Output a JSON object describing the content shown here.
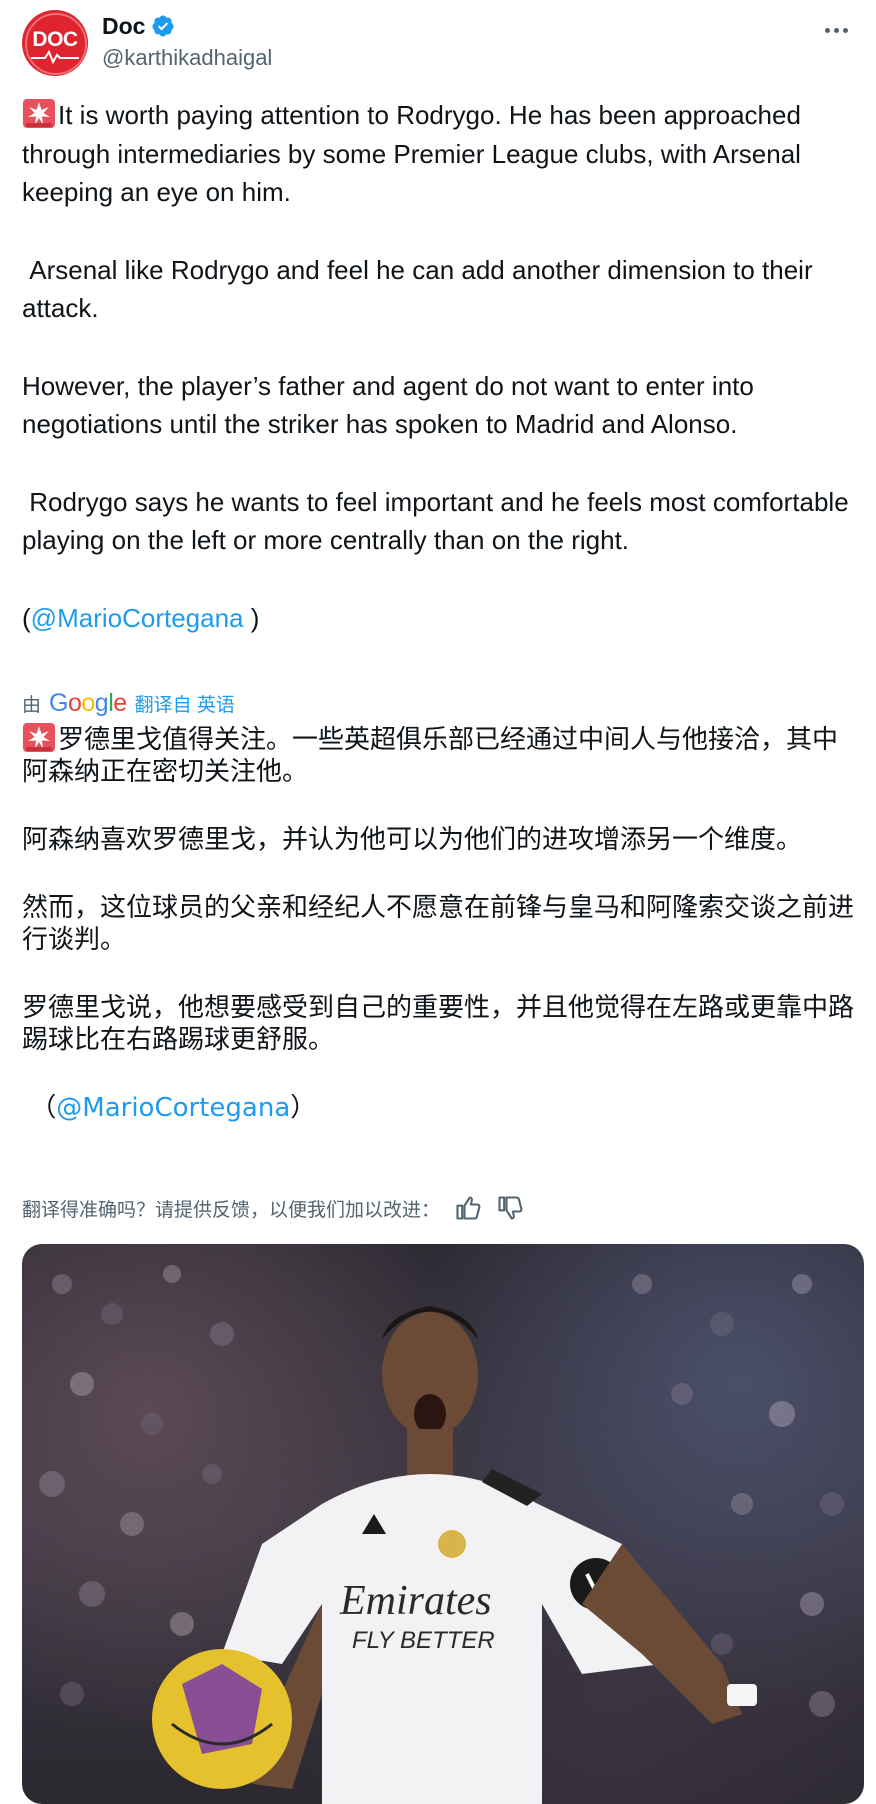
{
  "author": {
    "display_name": "Doc",
    "handle": "@karthikadhaigal",
    "avatar_text": "DOC",
    "verified": true
  },
  "tweet": {
    "paragraphs": [
      {
        "emoji": "rotating-light",
        "text": "It is worth paying attention to Rodrygo. He has been approached through intermediaries by some Premier League clubs, with Arsenal keeping an eye on him."
      },
      {
        "text": " Arsenal like Rodrygo and feel he can add another dimension to their attack."
      },
      {
        "text": "However, the player’s father and agent do not want to enter into negotiations until the striker has spoken to Madrid and Alonso."
      },
      {
        "text": " Rodrygo says he wants to feel important and he feels most comfortable playing on the left or more centrally than on the right."
      }
    ],
    "source_open": "(",
    "source_mention": "@MarioCortegana",
    "source_close": " )"
  },
  "translation": {
    "by_label": "由",
    "provider": "Google",
    "link_label": "翻译自 英语",
    "paragraphs": [
      {
        "emoji": "rotating-light",
        "text": "罗德里戈值得关注。一些英超俱乐部已经通过中间人与他接洽，其中阿森纳正在密切关注他。"
      },
      {
        "text": "阿森纳喜欢罗德里戈，并认为他可以为他们的进攻增添另一个维度。"
      },
      {
        "text": "然而，这位球员的父亲和经纪人不愿意在前锋与皇马和阿隆索交谈之前进行谈判。"
      },
      {
        "text": "罗德里戈说，他想要感受到自己的重要性，并且他觉得在左路或更靠中路踢球比在右路踢球更舒服。"
      }
    ],
    "source_open": "（",
    "source_mention": "@MarioCortegana",
    "source_close": "）"
  },
  "feedback": {
    "prompt": "翻译得准确吗？请提供反馈，以便我们加以改进：",
    "thumbs_up_icon": "thumbs-up-icon",
    "thumbs_down_icon": "thumbs-down-icon"
  },
  "media": {
    "shirt_sponsor_line1": "Emirates",
    "shirt_sponsor_line2": "FLY BETTER"
  },
  "colors": {
    "link": "#1d9bf0",
    "secondary_text": "#536471",
    "avatar_bg": "#e0242f"
  }
}
